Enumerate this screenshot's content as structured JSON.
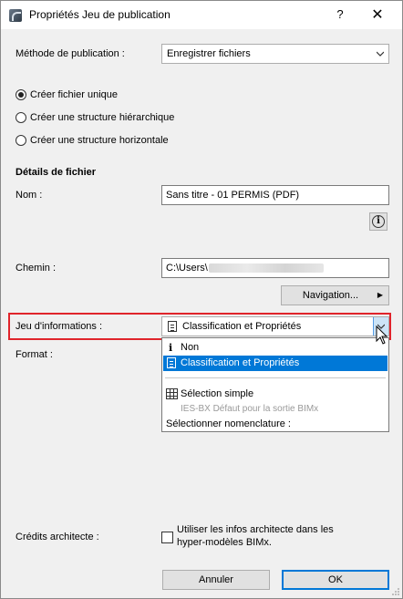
{
  "window": {
    "title": "Propriétés Jeu de publication",
    "help_glyph": "?",
    "close_glyph": "✕"
  },
  "publish_method": {
    "label": "Méthode de publication :",
    "value": "Enregistrer fichiers"
  },
  "file_options": [
    {
      "label": "Créer fichier unique",
      "checked": true
    },
    {
      "label": "Créer une structure hiérarchique",
      "checked": false
    },
    {
      "label": "Créer une structure horizontale",
      "checked": false
    }
  ],
  "file_details": {
    "heading": "Détails de fichier",
    "name_label": "Nom :",
    "name_value": "Sans titre - 01 PERMIS (PDF)",
    "info_glyph": "i",
    "path_label": "Chemin :",
    "path_value": "C:\\Users\\",
    "browse_label": "Navigation...",
    "browse_arrow": "▶"
  },
  "info_set": {
    "label": "Jeu d'informations :",
    "value": "Classification et Propriétés"
  },
  "format": {
    "label": "Format :"
  },
  "dropdown": {
    "items": [
      {
        "label": "Non",
        "icon": "info-icon",
        "state": "normal"
      },
      {
        "label": "Classification et Propriétés",
        "icon": "document-icon",
        "state": "selected"
      },
      {
        "label": "Sélection simple",
        "icon": "grid-icon",
        "state": "normal"
      },
      {
        "label": "IES-BX Défaut pour la sortie BIMx",
        "icon": "",
        "state": "disabled"
      },
      {
        "label": "Sélectionner nomenclature :",
        "icon": "",
        "state": "normal"
      }
    ]
  },
  "architect": {
    "label": "Crédits architecte :",
    "checkbox_line1": "Utiliser les infos architecte dans les",
    "checkbox_line2": "hyper-modèles BIMx.",
    "checked": false
  },
  "buttons": {
    "cancel": "Annuler",
    "ok": "OK"
  },
  "colors": {
    "highlight": "#e0242b",
    "selection": "#0078d7"
  }
}
